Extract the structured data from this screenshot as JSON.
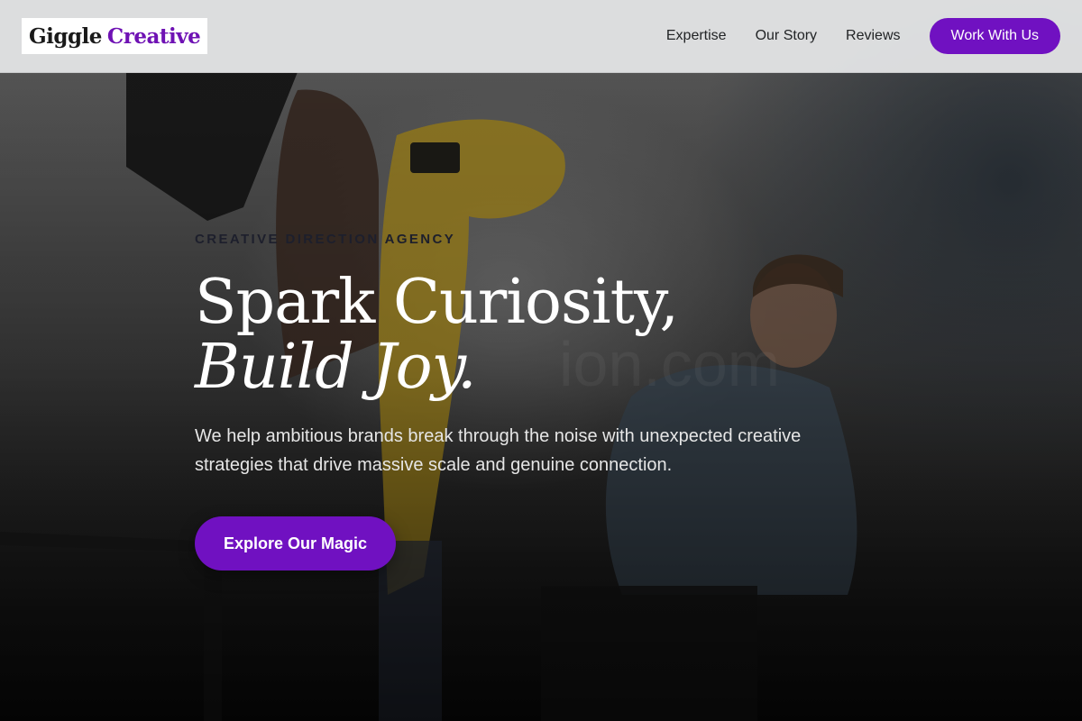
{
  "brand": {
    "name_primary": "Giggle",
    "name_accent": "Creative",
    "accent_color": "#6f12b4"
  },
  "nav": {
    "links": [
      {
        "label": "Expertise"
      },
      {
        "label": "Our Story"
      },
      {
        "label": "Reviews"
      }
    ],
    "cta_label": "Work With Us",
    "cta_color": "#7011c1"
  },
  "hero": {
    "eyebrow": "CREATIVE DIRECTION AGENCY",
    "headline_line1": "Spark Curiosity,",
    "headline_line2": "Build Joy.",
    "lede": "We help ambitious brands break through the noise with unexpected creative strategies that drive massive scale and genuine connection.",
    "cta_label": "Explore Our Magic",
    "background_subject": "photo-studio-scene"
  }
}
